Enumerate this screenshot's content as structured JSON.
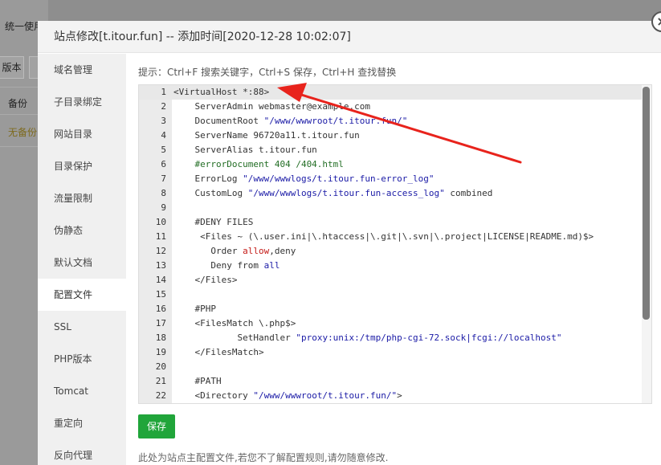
{
  "background": {
    "title_fragment": "统一使用",
    "button_fragment": "版本",
    "column_fragment": "备份",
    "status_fragment": "无备份"
  },
  "modal": {
    "title": "站点修改[t.itour.fun] -- 添加时间[2020-12-28 10:02:07]",
    "close_glyph": "×"
  },
  "sidebar": {
    "items": [
      {
        "label": "域名管理"
      },
      {
        "label": "子目录绑定"
      },
      {
        "label": "网站目录"
      },
      {
        "label": "目录保护"
      },
      {
        "label": "流量限制"
      },
      {
        "label": "伪静态"
      },
      {
        "label": "默认文档"
      },
      {
        "label": "配置文件"
      },
      {
        "label": "SSL"
      },
      {
        "label": "PHP版本"
      },
      {
        "label": "Tomcat"
      },
      {
        "label": "重定向"
      },
      {
        "label": "反向代理"
      }
    ],
    "active_index": 7
  },
  "content": {
    "tip": "提示：Ctrl+F 搜索关键字，Ctrl+S 保存，Ctrl+H 查找替换",
    "save_label": "保存",
    "footer_note": "此处为站点主配置文件,若您不了解配置规则,请勿随意修改."
  },
  "editor": {
    "active_line": 1,
    "lines": [
      {
        "num": "1",
        "text": "<VirtualHost *:88>"
      },
      {
        "num": "2",
        "text": "    ServerAdmin webmaster@example.com"
      },
      {
        "num": "3",
        "text": "    DocumentRoot \"/www/wwwroot/t.itour.fun/\""
      },
      {
        "num": "4",
        "text": "    ServerName 96720a11.t.itour.fun"
      },
      {
        "num": "5",
        "text": "    ServerAlias t.itour.fun"
      },
      {
        "num": "6",
        "text": "    #errorDocument 404 /404.html"
      },
      {
        "num": "7",
        "text": "    ErrorLog \"/www/wwwlogs/t.itour.fun-error_log\""
      },
      {
        "num": "8",
        "text": "    CustomLog \"/www/wwwlogs/t.itour.fun-access_log\" combined"
      },
      {
        "num": "9",
        "text": ""
      },
      {
        "num": "10",
        "text": "    #DENY FILES"
      },
      {
        "num": "11",
        "text": "     <Files ~ (\\.user.ini|\\.htaccess|\\.git|\\.svn|\\.project|LICENSE|README.md)$>"
      },
      {
        "num": "12",
        "text": "       Order allow,deny"
      },
      {
        "num": "13",
        "text": "       Deny from all"
      },
      {
        "num": "14",
        "text": "    </Files>"
      },
      {
        "num": "15",
        "text": ""
      },
      {
        "num": "16",
        "text": "    #PHP"
      },
      {
        "num": "17",
        "text": "    <FilesMatch \\.php$>"
      },
      {
        "num": "18",
        "text": "            SetHandler \"proxy:unix:/tmp/php-cgi-72.sock|fcgi://localhost\""
      },
      {
        "num": "19",
        "text": "    </FilesMatch>"
      },
      {
        "num": "20",
        "text": ""
      },
      {
        "num": "21",
        "text": "    #PATH"
      },
      {
        "num": "22",
        "text": "    <Directory \"/www/wwwroot/t.itour.fun/\">"
      }
    ]
  },
  "colors": {
    "accent_green": "#20a53a",
    "annotation_red": "#e8231c",
    "string_blue": "#1a1aa6",
    "comment_green": "#236e25"
  }
}
